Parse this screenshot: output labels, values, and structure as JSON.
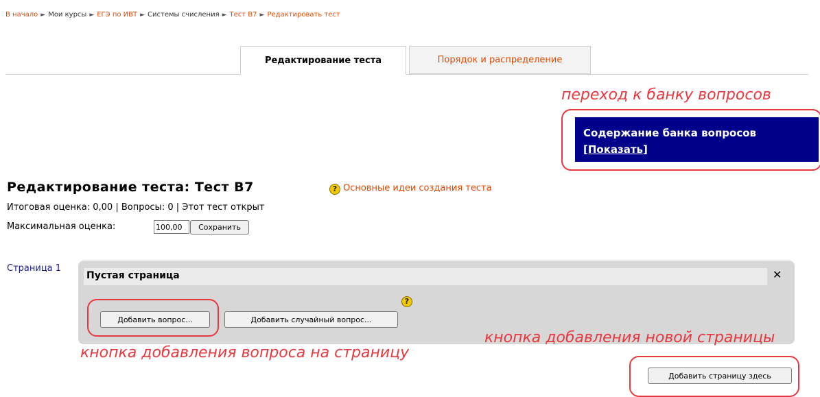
{
  "breadcrumb": {
    "items": [
      {
        "label": "В начало",
        "link": true
      },
      {
        "label": "Мои курсы",
        "link": false
      },
      {
        "label": "ЕГЭ по ИВТ",
        "link": true
      },
      {
        "label": "Системы счисления",
        "link": false
      },
      {
        "label": "Тест В7",
        "link": true
      },
      {
        "label": "Редактировать тест",
        "link": true
      }
    ],
    "separator": "►"
  },
  "tabs": [
    {
      "label": "Редактирование теста",
      "active": true
    },
    {
      "label": "Порядок и распределение",
      "active": false
    }
  ],
  "annotations": {
    "bank": "переход к банку вопросов",
    "new_page": "кнопка добавления новой страницы",
    "add_question": "кнопка добавления вопроса на страницу"
  },
  "question_bank": {
    "title": "Содержание банка вопросов",
    "show_link": "[Показать]"
  },
  "heading": {
    "title": "Редактирование теста: Тест В7",
    "help_link": "Основные идеи создания теста"
  },
  "summary": "Итоговая оценка: 0,00 | Вопросы: 0 | Этот тест открыт",
  "max_grade": {
    "label": "Максимальная оценка:",
    "value": "100,00",
    "save_label": "Сохранить"
  },
  "page": {
    "label": "Страница 1",
    "title": "Пустая страница",
    "close": "✕",
    "add_question": "Добавить вопрос...",
    "add_random": "Добавить случайный вопрос..."
  },
  "add_page_button": "Добавить страницу здесь",
  "help_glyph": "?",
  "colors": {
    "link": "#e04800",
    "annotation": "#e8383f",
    "bank_bg": "#00008b",
    "panel_bg": "#d7d7d7"
  }
}
